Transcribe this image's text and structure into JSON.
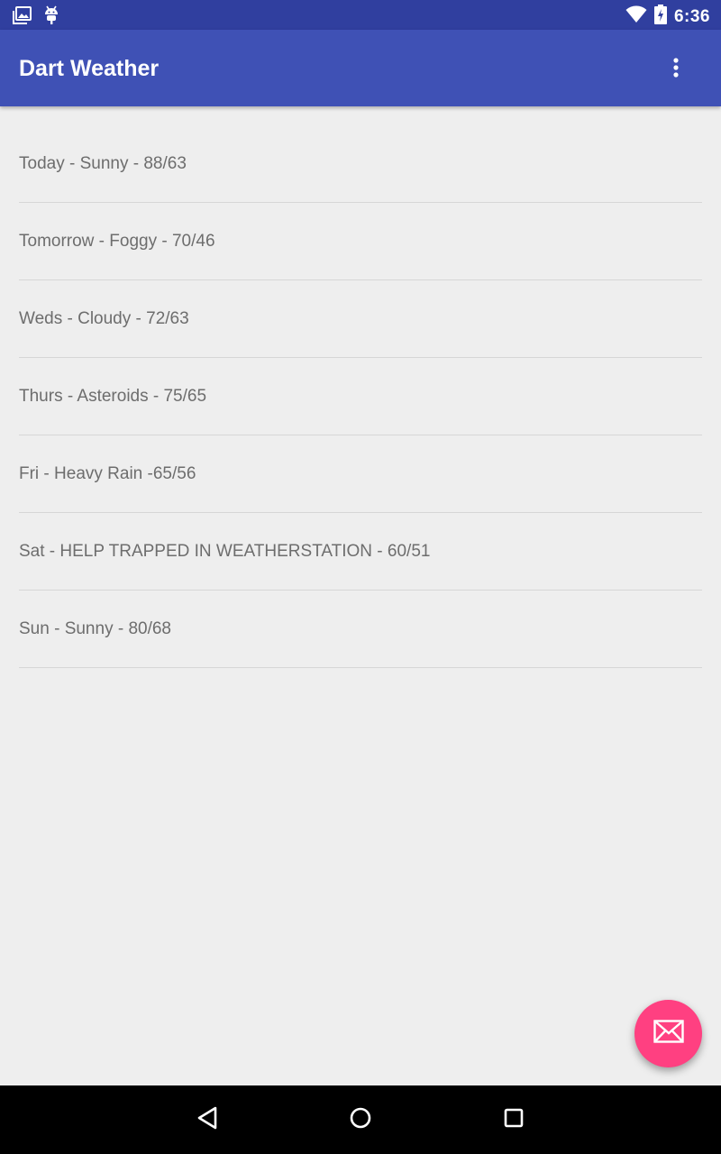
{
  "status_bar": {
    "time": "6:36",
    "left_icons": [
      "photo-notification-icon",
      "android-debug-icon"
    ],
    "right_icons": [
      "wifi-icon",
      "battery-charging-icon"
    ]
  },
  "app_bar": {
    "title": "Dart Weather",
    "overflow_icon": "more-vert-icon"
  },
  "forecast": [
    {
      "text": "Today - Sunny - 88/63"
    },
    {
      "text": "Tomorrow - Foggy - 70/46"
    },
    {
      "text": "Weds - Cloudy - 72/63"
    },
    {
      "text": "Thurs - Asteroids - 75/65"
    },
    {
      "text": "Fri - Heavy Rain -65/56"
    },
    {
      "text": "Sat - HELP TRAPPED IN WEATHERSTATION - 60/51"
    },
    {
      "text": "Sun - Sunny - 80/68"
    }
  ],
  "fab": {
    "icon": "email-icon"
  },
  "nav_bar": {
    "buttons": [
      "back-icon",
      "home-icon",
      "recents-icon"
    ]
  },
  "colors": {
    "primary": "#3f51b5",
    "primary_dark": "#303f9f",
    "accent": "#ff4081",
    "background": "#eeeeee",
    "list_text": "#6d6d6d",
    "divider": "#d6d6d6"
  }
}
